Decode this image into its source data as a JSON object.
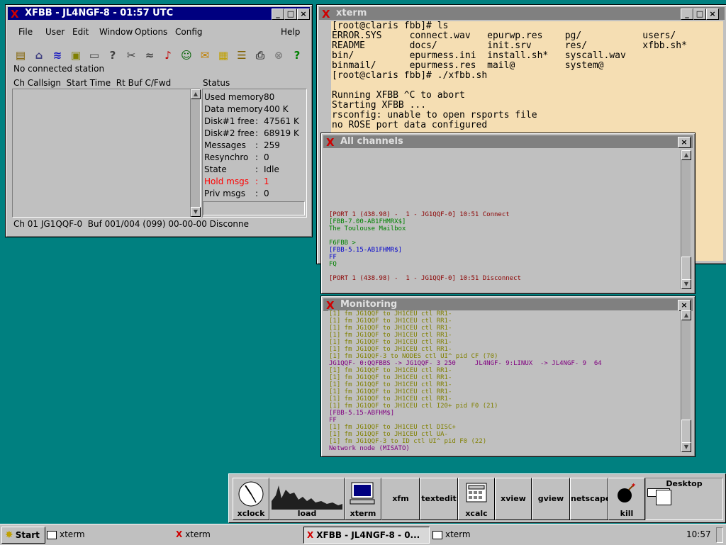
{
  "xfbb": {
    "title": "XFBB - JL4NGF-8 - 01:57 UTC",
    "menu": [
      "File",
      "User",
      "Edit",
      "Window",
      "Options",
      "Config",
      "Help"
    ],
    "toolbar_icons": [
      "connect-icon",
      "monitor-icon",
      "channels-icon",
      "windows-icon",
      "display-icon",
      "help-book-icon",
      "tools-icon",
      "radio-icon",
      "pager-icon",
      "person-icon",
      "mail-icon",
      "messages-icon",
      "list-icon",
      "print-icon",
      "stop-icon",
      "question-icon"
    ],
    "no_connected": "No connected station",
    "col_header": "Ch Callsign  Start Time  Rt Buf C/Fwd",
    "status_header": "Status",
    "status_rows": [
      {
        "label": "Used memory",
        "value": "80"
      },
      {
        "label": "Data memory",
        "value": "400 K"
      },
      {
        "label": "Disk#1 free",
        "value": "47561 K"
      },
      {
        "label": "Disk#2 free",
        "value": "68919 K"
      },
      {
        "label": "Messages",
        "value": "259"
      },
      {
        "label": "Resynchro",
        "value": "0"
      },
      {
        "label": "State",
        "value": "Idle"
      },
      {
        "label": "Hold msgs",
        "value": "1",
        "alert": true
      },
      {
        "label": "Priv msgs",
        "value": "0"
      }
    ],
    "statusbar": "Ch 01 JG1QQF-0  Buf 001/004 (099) 00-00-00 Disconne",
    "colors": {
      "alert": "#ff0000"
    }
  },
  "xterm": {
    "title": "xterm",
    "lines": [
      "[root@claris fbb]# ls",
      "ERROR.SYS     connect.wav   epurwp.res    pg/           users/",
      "README        docs/         init.srv      res/          xfbb.sh*",
      "bin/          epurmess.ini  install.sh*   syscall.wav",
      "binmail/      epurmess.res  mail@         system@",
      "[root@claris fbb]# ./xfbb.sh",
      "",
      "Running XFBB ^C to abort",
      "Starting XFBB ...",
      "rsconfig: unable to open rsports file",
      "no ROSE port data configured"
    ]
  },
  "allchannels": {
    "title": "All channels",
    "lines": [
      {
        "text": "[PORT 1 (438.98) -  1 - JG1QQF-0] 10:51 Connect",
        "color": "#8b0000"
      },
      {
        "text": "[FBB-7.00-AB1FHMRX$]",
        "color": "#008000"
      },
      {
        "text": "The Toulouse Mailbox",
        "color": "#008000"
      },
      {
        "text": "",
        "color": "#000"
      },
      {
        "text": "F6FBB >",
        "color": "#008000"
      },
      {
        "text": "[FBB-5.15-AB1FHMR$]",
        "color": "#0000cc"
      },
      {
        "text": "FF",
        "color": "#0000cc"
      },
      {
        "text": "FQ",
        "color": "#008000"
      },
      {
        "text": "",
        "color": "#000"
      },
      {
        "text": "[PORT 1 (438.98) -  1 - JG1QQF-0] 10:51 Disconnect",
        "color": "#8b0000"
      }
    ]
  },
  "monitoring": {
    "title": "Monitoring",
    "lines": [
      {
        "text": "[1] fm JG1QQF to JH1CEU ctl RR1-",
        "color": "#808000"
      },
      {
        "text": "[1] fm JG1QQF to JH1CEU ctl RR1-",
        "color": "#808000"
      },
      {
        "text": "[1] fm JG1QQF to JH1CEU ctl RR1-",
        "color": "#808000"
      },
      {
        "text": "[1] fm JG1QQF to JH1CEU ctl RR1-",
        "color": "#808000"
      },
      {
        "text": "[1] fm JG1QQF to JH1CEU ctl RR1-",
        "color": "#808000"
      },
      {
        "text": "[1] fm JG1QQF to JH1CEU ctl RR1-",
        "color": "#808000"
      },
      {
        "text": "[1] fm JG1QQF-3 to NODES ctl UI^ pid CF (70)",
        "color": "#808000"
      },
      {
        "text": "JG1QQF- 0:QQFBBS -> JG1QQF- 3 250     JL4NGF- 9:LINUX  -> JL4NGF- 9  64",
        "color": "#800080"
      },
      {
        "text": "[1] fm JG1QQF to JH1CEU ctl RR1-",
        "color": "#808000"
      },
      {
        "text": "[1] fm JG1QQF to JH1CEU ctl RR1-",
        "color": "#808000"
      },
      {
        "text": "[1] fm JG1QQF to JH1CEU ctl RR1-",
        "color": "#808000"
      },
      {
        "text": "[1] fm JG1QQF to JH1CEU ctl RR1-",
        "color": "#808000"
      },
      {
        "text": "[1] fm JG1QQF to JH1CEU ctl RR1-",
        "color": "#808000"
      },
      {
        "text": "[1] fm JG1QQF to JH1CEU ctl I20+ pid F0 (21)",
        "color": "#808000"
      },
      {
        "text": "[FBB-5.15-ABFHM$]",
        "color": "#800080"
      },
      {
        "text": "FF",
        "color": "#800080"
      },
      {
        "text": "[1] fm JG1QQF to JH1CEU ctl DISC+",
        "color": "#808000"
      },
      {
        "text": "[1] fm JG1QQF to JH1CEU ctl UA-",
        "color": "#808000"
      },
      {
        "text": "[1] fm JG1QQF-3 to ID ctl UI^ pid F0 (22)",
        "color": "#808000"
      },
      {
        "text": "Network node (MISATO)",
        "color": "#800080"
      }
    ]
  },
  "panel": {
    "buttons": [
      "xclock",
      "load",
      "xterm",
      "xfm",
      "textedit",
      "xcalc",
      "xview",
      "gview",
      "netscape",
      "kill"
    ],
    "desktop_label": "Desktop"
  },
  "taskbar": {
    "start": "Start",
    "tasks": [
      "xterm",
      "xterm",
      "XFBB - JL4NGF-8 - 0...",
      "xterm"
    ],
    "clock": "10:57"
  }
}
